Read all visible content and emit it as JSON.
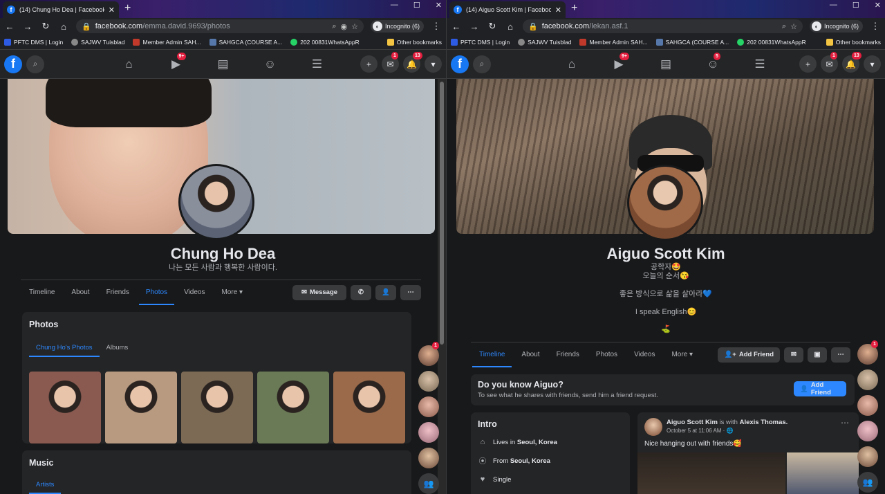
{
  "left": {
    "tab_title": "(14) Chung Ho Dea | Facebook",
    "url_host": "facebook.com",
    "url_path": "/emma.david.9693/photos",
    "incognito": "Incognito (6)",
    "bookmarks": [
      "PFTC DMS | Login",
      "SAJWV Tuisblad",
      "Member Admin SAH...",
      "SAHGCA (COURSE A...",
      "202 00831WhatsAppR"
    ],
    "other_bookmarks": "Other bookmarks",
    "nav_badge_watch": "9+",
    "badge_messenger": "1",
    "badge_notifications": "13",
    "profile_name": "Chung Ho Dea",
    "bio": "나는 모든 사람과 행복한 사람이다.",
    "tabs": [
      "Timeline",
      "About",
      "Friends",
      "Photos",
      "Videos",
      "More ▾"
    ],
    "message_label": "Message",
    "photos_title": "Photos",
    "photos_subtabs": [
      "Chung Ho's Photos",
      "Albums"
    ],
    "music_title": "Music",
    "music_subtab": "Artists",
    "rail_badge": "1",
    "thumb_colors": [
      "#8a5a50",
      "#b89a80",
      "#7c6a55",
      "#6a7a56",
      "#9a6a4a"
    ]
  },
  "right": {
    "tab_title": "(14) Aiguo Scott Kim | Facebook",
    "url_host": "facebook.com",
    "url_path": "/lekan.asf.1",
    "incognito": "Incognito (6)",
    "bookmarks": [
      "PFTC DMS | Login",
      "SAJWV Tuisblad",
      "Member Admin SAH...",
      "SAHGCA (COURSE A...",
      "202 00831WhatsAppR"
    ],
    "other_bookmarks": "Other bookmarks",
    "nav_badge_watch": "9+",
    "nav_badge_groups": "5",
    "badge_messenger": "1",
    "badge_notifications": "13",
    "profile_name": "Aiguo Scott Kim",
    "bio_lines": [
      "공학자🤩",
      "오늘의 순서😘",
      "좋은 방식으로 삶을 살아라💙",
      "I speak English😊",
      "⛳"
    ],
    "tabs": [
      "Timeline",
      "About",
      "Friends",
      "Photos",
      "Videos",
      "More ▾"
    ],
    "add_friend_label": "Add Friend",
    "know_title": "Do you know Aiguo?",
    "know_sub": "To see what he shares with friends, send him a friend request.",
    "know_btn": "Add Friend",
    "intro_title": "Intro",
    "intro_rows": [
      {
        "pre": "Lives in ",
        "bold": "Seoul, Korea"
      },
      {
        "pre": "From ",
        "bold": "Seoul, Korea"
      },
      {
        "pre": "Single",
        "bold": ""
      }
    ],
    "post_author": "Aiguo Scott Kim",
    "post_with": " is with ",
    "post_friend": "Alexis Thomas.",
    "post_time": "October 5 at 11:06 AM · 🌐",
    "post_text": "Nice hanging out with friends🥰",
    "rail_badge": "1"
  }
}
